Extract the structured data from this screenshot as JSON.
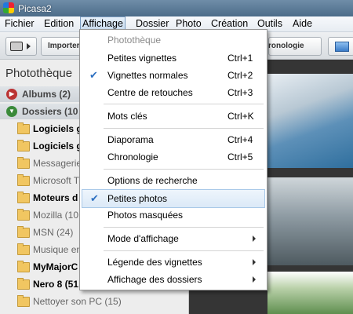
{
  "window": {
    "title": "Picasa2"
  },
  "menubar": [
    "Fichier",
    "Edition",
    "Affichage",
    "Dossier",
    "Photo",
    "Création",
    "Outils",
    "Aide"
  ],
  "toolbar": {
    "import_label": "Importer",
    "chrono_label": "ronologie"
  },
  "left_panel": {
    "title": "Photothèque",
    "albums": "Albums (2)",
    "dossiers": "Dossiers (10",
    "folders": [
      "Logiciels g",
      "Logiciels g",
      "Messagerie",
      "Microsoft T",
      "Moteurs d",
      "Mozilla (10",
      "MSN (24)",
      "Musique en",
      "MyMajorC",
      "Nero 8 (51",
      "Nettoyer son PC (15)"
    ]
  },
  "menu": {
    "header": "Photothèque",
    "items": {
      "petites_vignettes": {
        "label": "Petites vignettes",
        "shortcut": "Ctrl+1"
      },
      "vignettes_normales": {
        "label": "Vignettes normales",
        "shortcut": "Ctrl+2"
      },
      "centre_retouches": {
        "label": "Centre de retouches",
        "shortcut": "Ctrl+3"
      },
      "mots_cles": {
        "label": "Mots clés",
        "shortcut": "Ctrl+K"
      },
      "diaporama": {
        "label": "Diaporama",
        "shortcut": "Ctrl+4"
      },
      "chronologie": {
        "label": "Chronologie",
        "shortcut": "Ctrl+5"
      },
      "options_recherche": {
        "label": "Options de recherche"
      },
      "petites_photos": {
        "label": "Petites photos"
      },
      "photos_masquees": {
        "label": "Photos masquées"
      },
      "mode_affichage": {
        "label": "Mode d'affichage"
      },
      "legende_vignettes": {
        "label": "Légende des vignettes"
      },
      "affichage_dossiers": {
        "label": "Affichage des dossiers"
      }
    }
  },
  "colors": {
    "accent": "#2d6fc1",
    "highlight": "#dbe9f7",
    "photo_bg": "#353535"
  }
}
